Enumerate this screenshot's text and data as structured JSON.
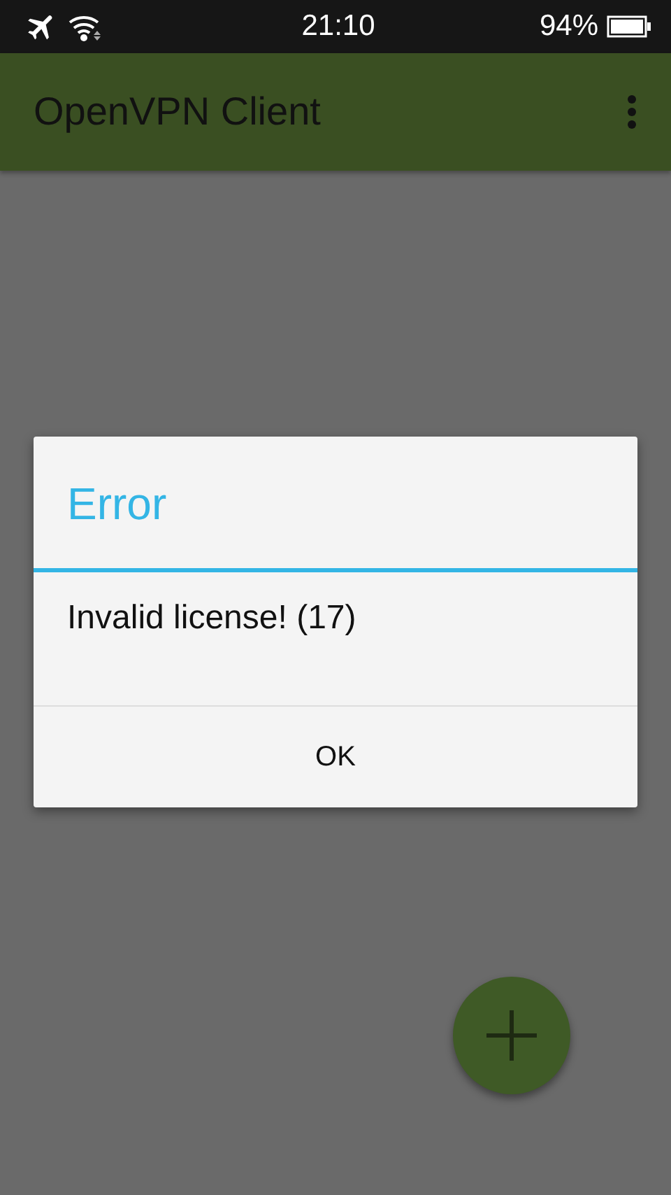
{
  "status_bar": {
    "time": "21:10",
    "battery": "94%"
  },
  "app_bar": {
    "title": "OpenVPN Client"
  },
  "dialog": {
    "title": "Error",
    "message": "Invalid license! (17)",
    "buttons": [
      "OK"
    ]
  }
}
